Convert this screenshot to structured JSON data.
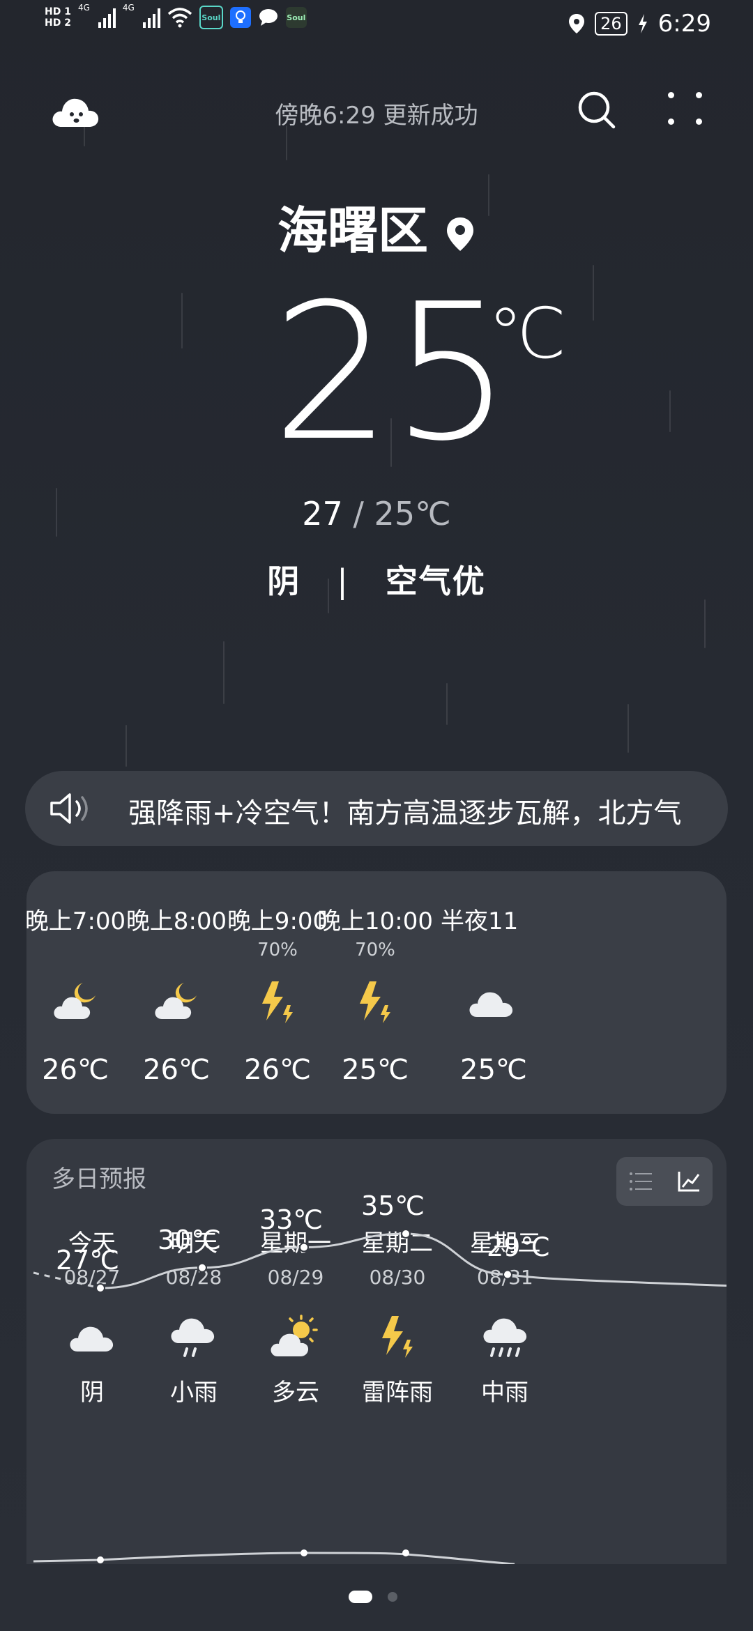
{
  "status_bar": {
    "hd1": "HD 1",
    "hd2": "HD 2",
    "net1": "4G",
    "net2": "4G",
    "app_badge_1": "Soul",
    "app_badge_2": "Soul",
    "battery_level": "26",
    "time": "6:29"
  },
  "header": {
    "update_text": "傍晚6:29 更新成功"
  },
  "location": {
    "city": "海曙区"
  },
  "current": {
    "temperature": "25",
    "unit": "℃",
    "high": "27",
    "sep": " / ",
    "low": "25℃",
    "condition": "阴",
    "divider": "|",
    "air": "空气优"
  },
  "alert": {
    "text": "强降雨+冷空气！南方高温逐步瓦解，北方气"
  },
  "hourly": [
    {
      "time": "晚上7:00",
      "precip": "",
      "icon": "night-partly-cloudy-icon",
      "temp": "26℃"
    },
    {
      "time": "晚上8:00",
      "precip": "",
      "icon": "night-partly-cloudy-icon",
      "temp": "26℃"
    },
    {
      "time": "晚上9:00",
      "precip": "70%",
      "icon": "thunder-icon",
      "temp": "26℃"
    },
    {
      "time": "晚上10:00",
      "precip": "70%",
      "icon": "thunder-icon",
      "temp": "25℃"
    },
    {
      "time": "半夜11",
      "precip": "",
      "icon": "cloud-icon",
      "temp": "25℃"
    }
  ],
  "daily": {
    "title": "多日预报",
    "days": [
      {
        "day": "今天",
        "date": "08/27",
        "icon": "cloud-icon",
        "weather": "阴",
        "high": "27℃"
      },
      {
        "day": "明天",
        "date": "08/28",
        "icon": "light-rain-icon",
        "weather": "小雨",
        "high": "30℃"
      },
      {
        "day": "星期一",
        "date": "08/29",
        "icon": "partly-cloudy-icon",
        "weather": "多云",
        "high": "33℃"
      },
      {
        "day": "星期二",
        "date": "08/30",
        "icon": "thunder-icon",
        "weather": "雷阵雨",
        "high": "35℃"
      },
      {
        "day": "星期三",
        "date": "08/31",
        "icon": "moderate-rain-icon",
        "weather": "中雨",
        "high": "29℃"
      }
    ],
    "high_values": [
      27,
      30,
      33,
      35,
      29
    ],
    "accent_line": "#cfd2d6"
  }
}
